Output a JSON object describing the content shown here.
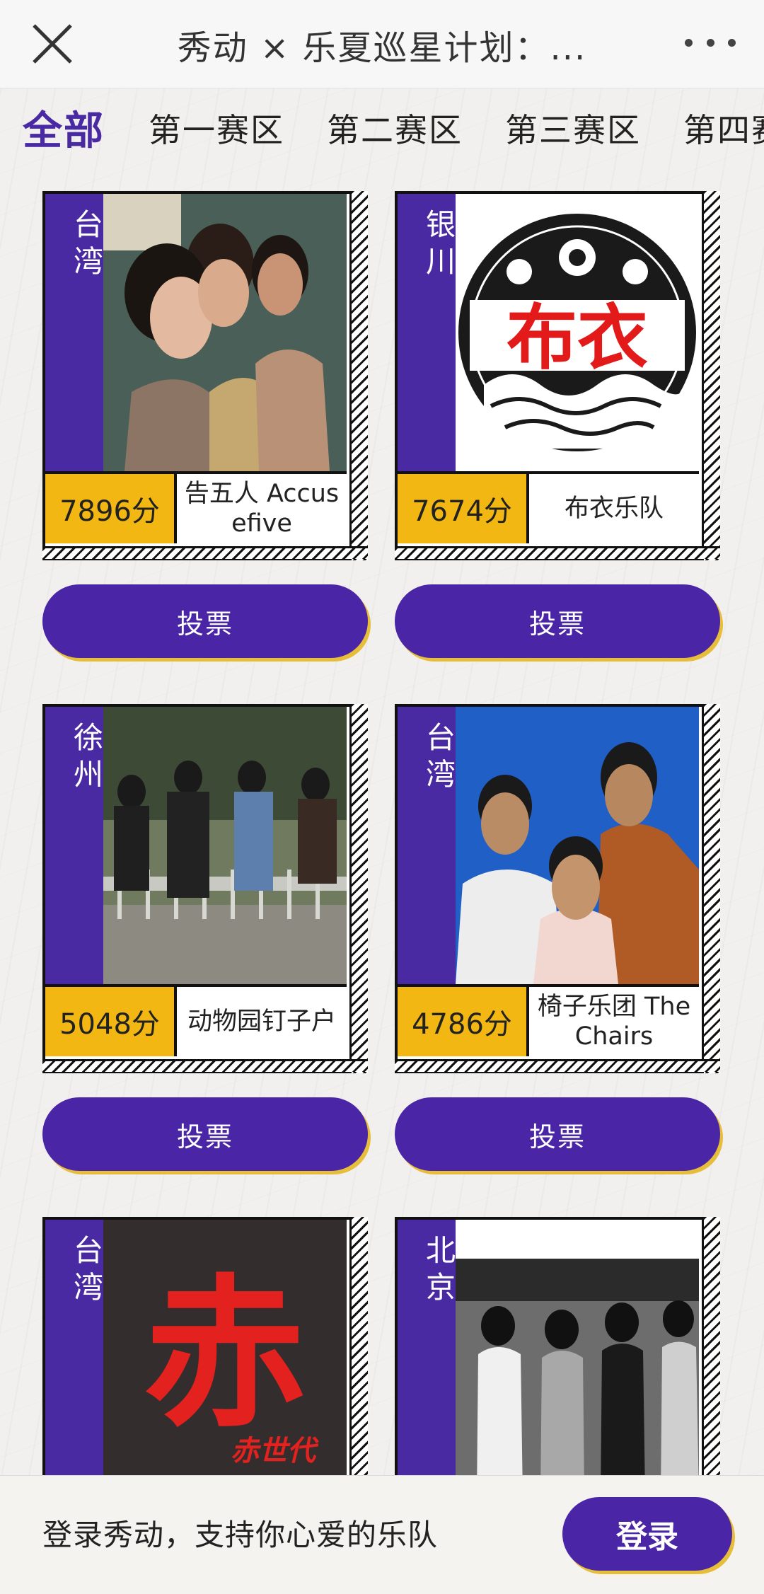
{
  "navbar": {
    "title": "秀动 × 乐夏巡星计划：...",
    "close_icon": "close-icon",
    "more_icon": "more-dots-icon"
  },
  "tabs": [
    {
      "label": "全部",
      "active": true
    },
    {
      "label": "第一赛区",
      "active": false
    },
    {
      "label": "第二赛区",
      "active": false
    },
    {
      "label": "第三赛区",
      "active": false
    },
    {
      "label": "第四赛",
      "active": false
    }
  ],
  "bands": [
    {
      "city": "台湾",
      "score": "7896分",
      "name": "告五人 Accusefive",
      "vote": "投票",
      "photo": "band-photo"
    },
    {
      "city": "银川",
      "score": "7674分",
      "name": "布衣乐队",
      "vote": "投票",
      "photo": "band-logo",
      "logo_text": "布衣"
    },
    {
      "city": "徐州",
      "score": "5048分",
      "name": "动物园钉子户",
      "vote": "投票",
      "photo": "band-photo"
    },
    {
      "city": "台湾",
      "score": "4786分",
      "name": "椅子乐团 The Chairs",
      "vote": "投票",
      "photo": "band-photo"
    },
    {
      "city": "台湾",
      "score": "",
      "name": "",
      "vote": "",
      "photo": "album-cover",
      "logo_text": "赤",
      "logo_sub": "赤世代"
    },
    {
      "city": "北京",
      "score": "",
      "name": "",
      "vote": "",
      "photo": "band-photo"
    }
  ],
  "login_bar": {
    "text": "登录秀动，支持你心爱的乐队",
    "button": "登录"
  },
  "colors": {
    "purple": "#4a2aa3",
    "yellow": "#f2b713",
    "shadow_yellow": "#e7be3a"
  }
}
